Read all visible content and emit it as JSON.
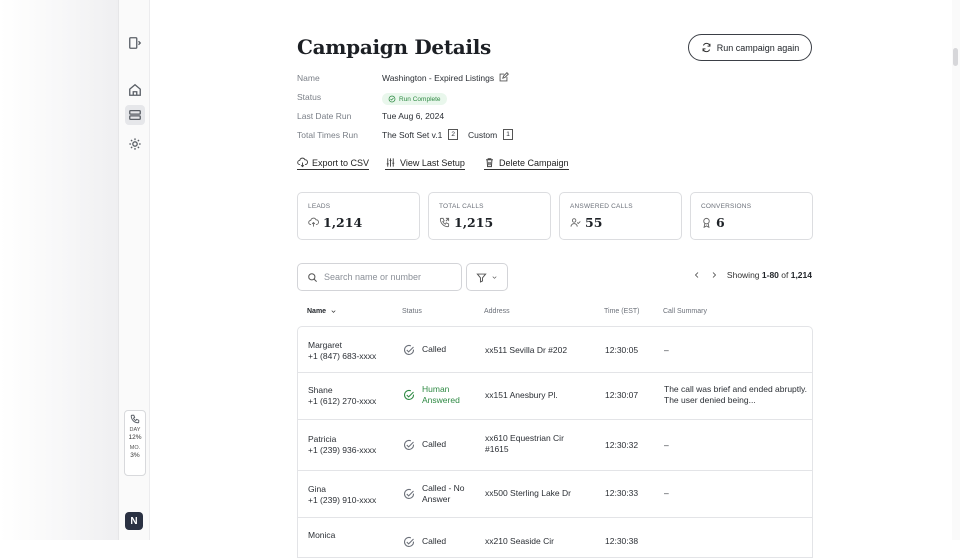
{
  "page": {
    "title": "Campaign Details",
    "run_again_label": "Run campaign again"
  },
  "details": {
    "name_label": "Name",
    "name_value": "Washington - Expired Listings",
    "status_label": "Status",
    "status_value": "Run Complete",
    "last_run_label": "Last Date Run",
    "last_run_value": "Tue Aug 6, 2024",
    "times_run_label": "Total Times Run",
    "times_run_set": "The Soft Set v.1",
    "times_run_set_count": "2",
    "times_run_custom": "Custom",
    "times_run_custom_count": "1"
  },
  "actions": {
    "export": "Export to CSV",
    "view_setup": "View Last Setup",
    "delete": "Delete Campaign"
  },
  "stats": [
    {
      "label": "LEADS",
      "value": "1,214",
      "icon": "upload-cloud-icon"
    },
    {
      "label": "TOTAL CALLS",
      "value": "1,215",
      "icon": "phone-outgoing-icon"
    },
    {
      "label": "ANSWERED CALLS",
      "value": "55",
      "icon": "user-check-icon"
    },
    {
      "label": "CONVERSIONS",
      "value": "6",
      "icon": "award-icon"
    }
  ],
  "search": {
    "placeholder": "Search name or number"
  },
  "pager": {
    "prefix": "Showing ",
    "range": "1-80",
    "of": " of ",
    "total": "1,214"
  },
  "table": {
    "headers": {
      "name": "Name",
      "status": "Status",
      "address": "Address",
      "time": "Time (EST)",
      "summary": "Call Summary"
    },
    "rows": [
      {
        "name": "Margaret",
        "phone": "+1 (847) 683-xxxx",
        "status": "Called",
        "address": "xx511 Sevilla Dr #202",
        "time": "12:30:05",
        "summary": "–"
      },
      {
        "name": "Shane",
        "phone": "+1 (612) 270-xxxx",
        "status": "Human Answered",
        "address": "xx151 Anesbury Pl.",
        "time": "12:30:07",
        "summary": "The call was brief and ended abruptly. The user denied being..."
      },
      {
        "name": "Patricia",
        "phone": "+1 (239) 936-xxxx",
        "status": "Called",
        "address": "xx610 Equestrian Cir #1615",
        "time": "12:30:32",
        "summary": "–"
      },
      {
        "name": "Gina",
        "phone": "+1 (239) 910-xxxx",
        "status": "Called - No Answer",
        "address": "xx500 Sterling Lake Dr",
        "time": "12:30:33",
        "summary": "–"
      },
      {
        "name": "Monica",
        "phone": "",
        "status": "Called",
        "address": "xx210 Seaside Cir",
        "time": "12:30:38",
        "summary": ""
      }
    ]
  },
  "sidebar": {
    "usage_day_label": "DAY",
    "usage_day_value": "12%",
    "usage_mo_label": "MO.",
    "usage_mo_value": "3%",
    "avatar_initial": "N"
  },
  "colors": {
    "accent_green": "#2f8a44",
    "badge_bg": "#e9f7ec",
    "avatar_bg": "#2a3142"
  }
}
